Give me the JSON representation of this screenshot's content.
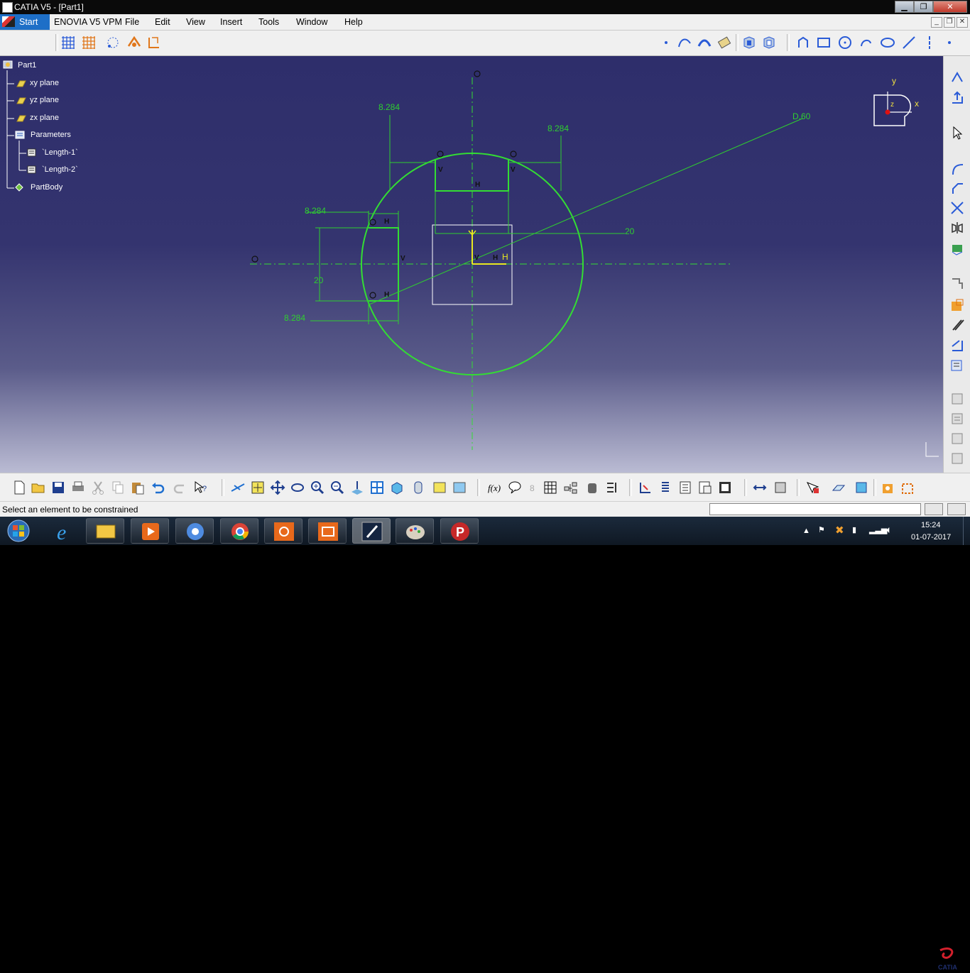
{
  "window": {
    "title": "CATIA V5 - [Part1]"
  },
  "menu": {
    "start": "Start",
    "items": [
      "ENOVIA V5 VPM",
      "File",
      "Edit",
      "View",
      "Insert",
      "Tools",
      "Window",
      "Help"
    ]
  },
  "tree": {
    "root": "Part1",
    "xy_plane": "xy plane",
    "yz_plane": "yz plane",
    "zx_plane": "zx plane",
    "parameters": "Parameters",
    "length1": "`Length-1`",
    "length2": "`Length-2`",
    "partbody": "PartBody"
  },
  "sketch": {
    "dim_top_left": "8.284",
    "dim_top_right": "8.284",
    "dim_left_top": "8.284",
    "dim_left_bottom": "8.284",
    "dim_left_height": "20",
    "dim_right_20": "20",
    "dim_diameter": "D.60",
    "label_h_top": "H",
    "label_v_top_left": "V",
    "label_v_top_right": "V",
    "label_h_left_top": "H",
    "label_h_left_bottom": "H",
    "label_v_left": "V",
    "label_axis_h": "H",
    "label_axis_v": "V",
    "label_center_h": "H"
  },
  "compass": {
    "y": "y",
    "x": "x",
    "z": "z"
  },
  "status": {
    "message": "Select an element to be constrained"
  },
  "tray": {
    "time": "15:24",
    "date": "01-07-2017"
  },
  "colors": {
    "sketch_green": "#33dd33",
    "dim_green": "#2fcf2f",
    "canvas_top": "#2e2e6b",
    "canvas_bottom": "#babbd3",
    "start_blue": "#1e6fc7"
  },
  "icons": {
    "taskbar": [
      "windows-start-icon",
      "internet-explorer-icon",
      "file-explorer-icon",
      "media-player-icon",
      "chromium-icon",
      "chrome-icon",
      "screenshot-tool-icon",
      "camera-icon",
      "catia-icon",
      "paint-icon",
      "psiphon-icon"
    ]
  }
}
